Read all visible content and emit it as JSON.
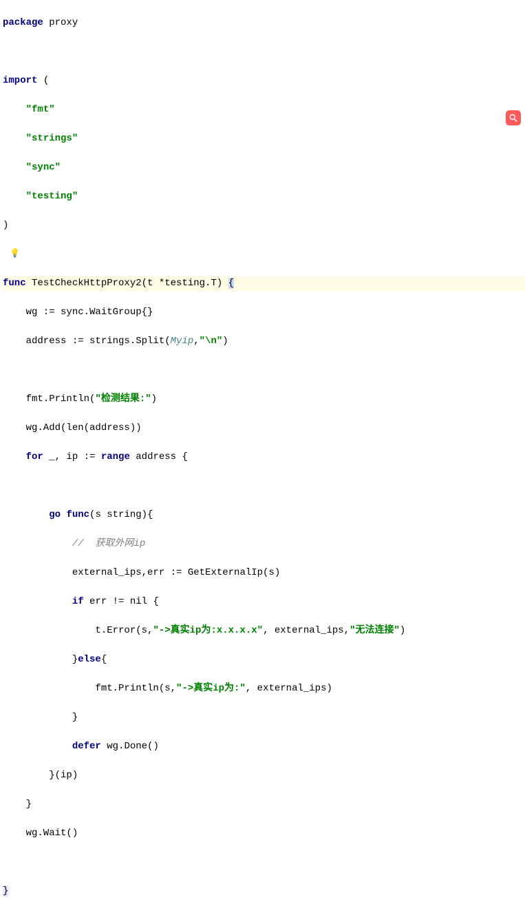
{
  "code": {
    "l1_kw": "package",
    "l1_name": " proxy",
    "l3_kw": "import",
    "l3_paren": " (",
    "l4_str": "\"fmt\"",
    "l5_str": "\"strings\"",
    "l6_str": "\"sync\"",
    "l7_str": "\"testing\"",
    "l8_paren": ")",
    "l10_func": "func",
    "l10_name": " TestCheckHttpProxy2(t *testing.T) ",
    "l10_brace": "{",
    "l11": "    wg := sync.WaitGroup{}",
    "l12_a": "    address := strings.Split(",
    "l12_myip": "Myip",
    "l12_b": ",",
    "l12_str": "\"\\n\"",
    "l12_c": ")",
    "l14_a": "    fmt.Println(",
    "l14_str": "\"检测结果:\"",
    "l14_b": ")",
    "l15": "    wg.Add(len(address))",
    "l16_a": "    ",
    "l16_for": "for",
    "l16_b": " _, ip := ",
    "l16_range": "range",
    "l16_c": " address {",
    "l18_a": "        ",
    "l18_go": "go",
    "l18_b": " ",
    "l18_func": "func",
    "l18_c": "(s string){",
    "l19_a": "            ",
    "l19_comment": "//  获取外网ip",
    "l20": "            external_ips,err := GetExternalIp(s)",
    "l21_a": "            ",
    "l21_if": "if",
    "l21_b": " err != nil {",
    "l22_a": "                t.Error(s,",
    "l22_str1": "\"->真实ip为:x.x.x.x\"",
    "l22_b": ", external_ips,",
    "l22_str2": "\"无法连接\"",
    "l22_c": ")",
    "l23_a": "            }",
    "l23_else": "else",
    "l23_b": "{",
    "l24_a": "                fmt.Println(s,",
    "l24_str": "\"->真实ip为:\"",
    "l24_b": ", external_ips)",
    "l25": "            }",
    "l26_a": "            ",
    "l26_defer": "defer",
    "l26_b": " wg.Done()",
    "l27": "        }(ip)",
    "l28": "    }",
    "l29": "    wg.Wait()",
    "l31_brace": "}"
  }
}
